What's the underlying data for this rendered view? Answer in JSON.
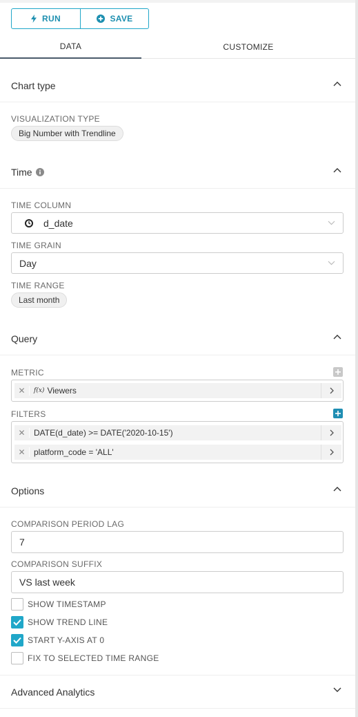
{
  "toolbar": {
    "run_label": "RUN",
    "save_label": "SAVE"
  },
  "tabs": [
    {
      "label": "DATA",
      "active": true
    },
    {
      "label": "CUSTOMIZE",
      "active": false
    }
  ],
  "sections": {
    "chart_type": {
      "title": "Chart type",
      "viz_label": "VISUALIZATION TYPE",
      "viz_value": "Big Number with Trendline"
    },
    "time": {
      "title": "Time",
      "column_label": "TIME COLUMN",
      "column_value": "d_date",
      "grain_label": "TIME GRAIN",
      "grain_value": "Day",
      "range_label": "TIME RANGE",
      "range_value": "Last month"
    },
    "query": {
      "title": "Query",
      "metric_label": "METRIC",
      "metric_prefix": "f(x)",
      "metric_value": "Viewers",
      "filters_label": "FILTERS",
      "filters": [
        "DATE(d_date) >= DATE('2020-10-15')",
        "platform_code = 'ALL'"
      ]
    },
    "options": {
      "title": "Options",
      "lag_label": "COMPARISON PERIOD LAG",
      "lag_value": "7",
      "suffix_label": "COMPARISON SUFFIX",
      "suffix_value": "VS last week",
      "checkboxes": [
        {
          "label": "SHOW TIMESTAMP",
          "checked": false
        },
        {
          "label": "SHOW TREND LINE",
          "checked": true
        },
        {
          "label": "START Y-AXIS AT 0",
          "checked": true
        },
        {
          "label": "FIX TO SELECTED TIME RANGE",
          "checked": false
        }
      ]
    },
    "advanced": {
      "title": "Advanced Analytics"
    }
  },
  "colors": {
    "accent": "#20a7c9",
    "accent_dark": "#1f8eb3",
    "tab_underline": "#4a5a6a"
  },
  "icons": {
    "run": "lightning-icon",
    "save": "plus-circle-icon",
    "info": "info-icon",
    "clock": "clock-icon",
    "chevron_up": "chevron-up-icon",
    "chevron_down": "chevron-down-icon",
    "remove": "close-icon",
    "go": "chevron-right-icon",
    "add": "plus-icon"
  }
}
